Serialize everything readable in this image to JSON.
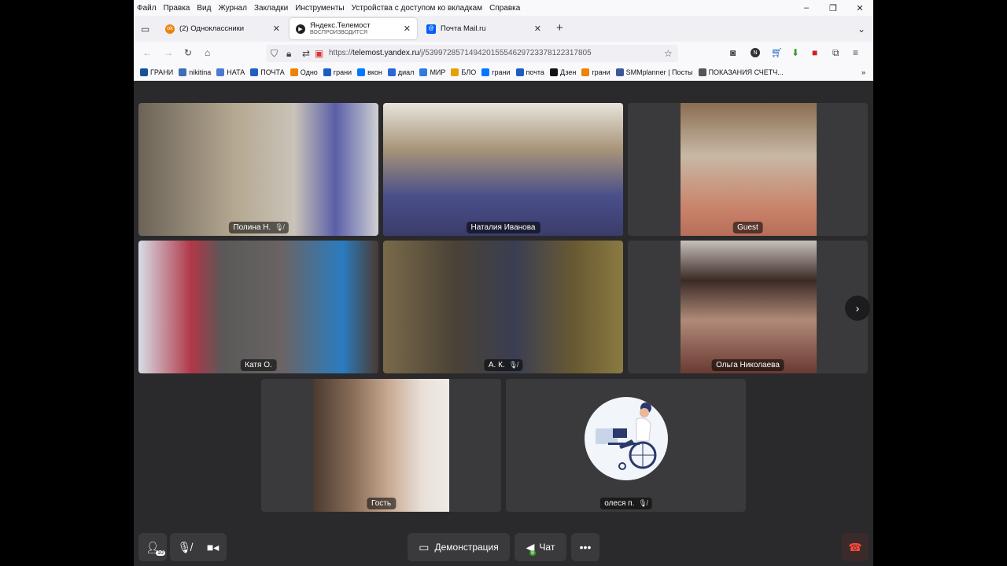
{
  "menu": [
    "Файл",
    "Правка",
    "Вид",
    "Журнал",
    "Закладки",
    "Инструменты",
    "Устройства с доступом ко вкладкам",
    "Справка"
  ],
  "window_controls": {
    "minimize": "–",
    "restore": "❐",
    "close": "✕"
  },
  "tabs": [
    {
      "title": "(2) Одноклассники",
      "subtitle": "",
      "favicon": "ok-icon",
      "color": "#ee8208"
    },
    {
      "title": "Яндекс.Телемост",
      "subtitle": "ВОСПРОИЗВОДИТСЯ",
      "favicon": "telemost-icon",
      "color": "#222222"
    },
    {
      "title": "Почта Mail.ru",
      "subtitle": "",
      "favicon": "mail-icon",
      "color": "#005ff9"
    }
  ],
  "url": {
    "prefix": "https://",
    "host": "telemost.yandex.ru",
    "path": "/j/53997285714942015554629723378122317805"
  },
  "bookmarks": [
    {
      "label": "ГРАНИ",
      "color": "#1a4f9c"
    },
    {
      "label": "nikitina",
      "color": "#3c6fb4"
    },
    {
      "label": "НАТА",
      "color": "#4a7bd0"
    },
    {
      "label": "ПОЧТА",
      "color": "#1f5fbf"
    },
    {
      "label": "Одно",
      "color": "#ee8208"
    },
    {
      "label": "грани",
      "color": "#1a5fc0"
    },
    {
      "label": "вкон",
      "color": "#0077ff"
    },
    {
      "label": "диал",
      "color": "#2a6ad0"
    },
    {
      "label": "МИР",
      "color": "#2f7be0"
    },
    {
      "label": "БЛО",
      "color": "#e8a000"
    },
    {
      "label": "грани",
      "color": "#0077ff"
    },
    {
      "label": "почта",
      "color": "#1a5fc0"
    },
    {
      "label": "Дзен",
      "color": "#111111"
    },
    {
      "label": "грани",
      "color": "#ee8208"
    },
    {
      "label": "SMMplanner | Посты",
      "color": "#3b5998"
    },
    {
      "label": "ПОКАЗАНИЯ СЧЕТЧ...",
      "color": "#555555"
    }
  ],
  "participants": [
    {
      "name": "Полина Н.",
      "muted": true,
      "speaking": false
    },
    {
      "name": "Наталия Иванова",
      "muted": false,
      "speaking": true
    },
    {
      "name": "Guest",
      "muted": false,
      "speaking": false
    },
    {
      "name": "Катя О.",
      "muted": false,
      "speaking": false
    },
    {
      "name": "А. К.",
      "muted": true,
      "speaking": false
    },
    {
      "name": "Ольга Николаева",
      "muted": false,
      "speaking": false
    },
    {
      "name": "Гость",
      "muted": false,
      "speaking": false
    },
    {
      "name": "олеся п.",
      "muted": true,
      "speaking": false
    }
  ],
  "controls": {
    "participants_count": "10",
    "demo_label": "Демонстрация",
    "chat_label": "Чат",
    "chat_badge": "8"
  }
}
